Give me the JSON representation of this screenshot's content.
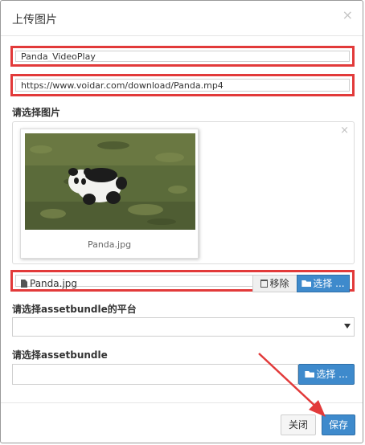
{
  "dialog": {
    "title": "上传图片",
    "close_glyph": "×"
  },
  "name_field": {
    "value": "Panda_VideoPlay"
  },
  "url_field": {
    "value": "https://www.voidar.com/download/Panda.mp4"
  },
  "image_section": {
    "label": "请选择图片",
    "preview_close_glyph": "×",
    "thumbnail_caption": "Panda.jpg",
    "file_name": "Panda.jpg",
    "remove_label": "移除",
    "choose_label": "选择 ..."
  },
  "platform_section": {
    "label": "请选择assetbundle的平台",
    "selected_value": ""
  },
  "assetbundle_section": {
    "label": "请选择assetbundle",
    "value": "",
    "choose_label": "选择 ..."
  },
  "footer": {
    "close_label": "关闭",
    "save_label": "保存"
  },
  "colors": {
    "highlight": "#e23a3a",
    "primary": "#3e8acc"
  }
}
